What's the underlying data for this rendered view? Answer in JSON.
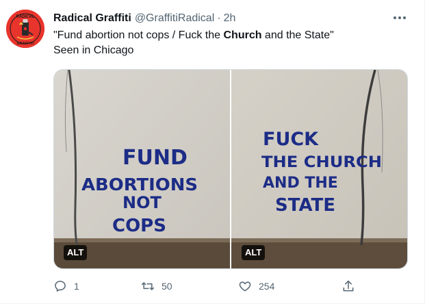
{
  "tweet": {
    "display_name": "Radical Graffiti",
    "handle": "@GraffitiRadical",
    "separator": "·",
    "time": "2h",
    "text_line1_a": "\"Fund abortion not cops / Fuck the ",
    "text_line1_bold": "Church",
    "text_line1_b": " and the State\"",
    "text_line2": "Seen in Chicago",
    "avatar_text_top": "RADICAL",
    "avatar_text_bottom": "GRAFFITI"
  },
  "media": {
    "left_alt": "ALT",
    "right_alt": "ALT",
    "left_graffiti": [
      "FUND",
      "ABORTIONS",
      "NOT",
      "COPS"
    ],
    "right_graffiti": [
      "FUCK",
      "THE CHURCH",
      "AND THE",
      "STATE"
    ]
  },
  "actions": {
    "replies": "1",
    "retweets": "50",
    "likes": "254"
  },
  "colors": {
    "avatar_bg": "#e8342c",
    "muted_text": "#536471",
    "graffiti_blue": "#1c2c86"
  }
}
